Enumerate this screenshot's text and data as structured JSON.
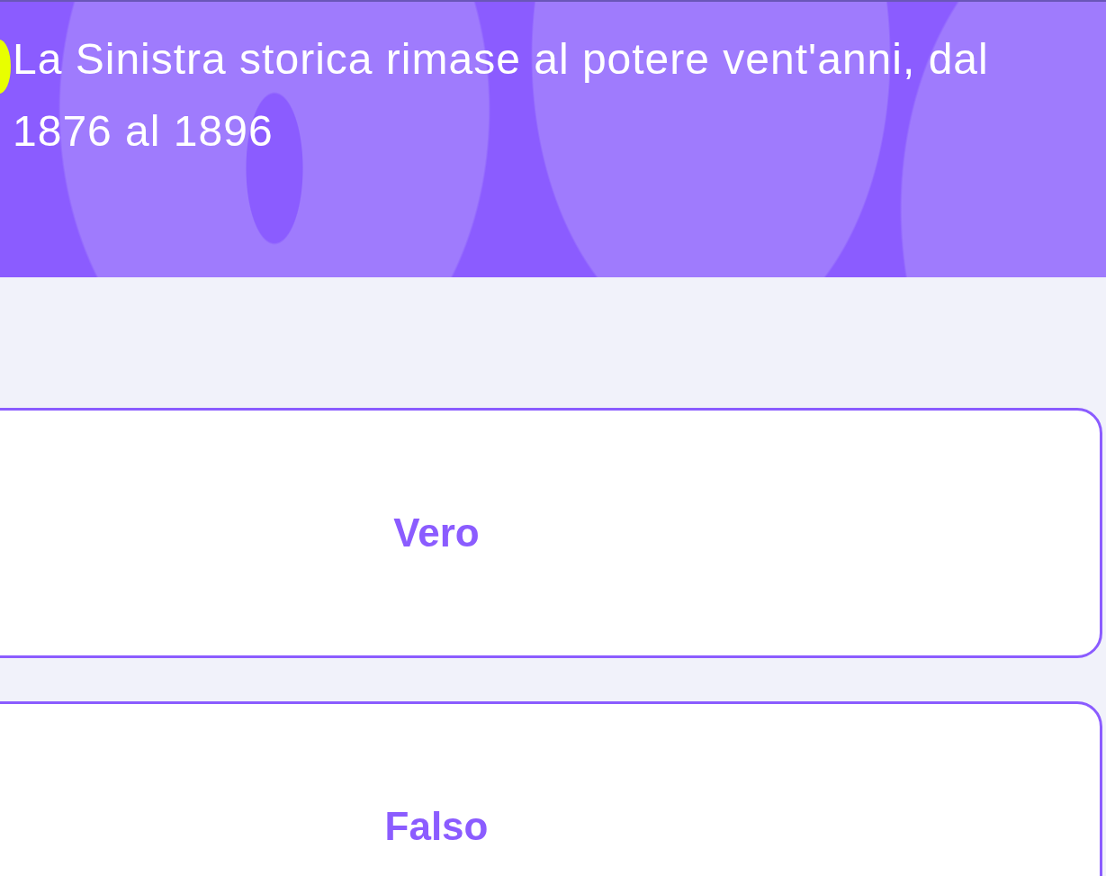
{
  "question": {
    "text": "La Sinistra storica rimase al potere vent'anni, dal 1876 al 1896"
  },
  "options": [
    {
      "label": "Vero"
    },
    {
      "label": "Falso"
    }
  ]
}
